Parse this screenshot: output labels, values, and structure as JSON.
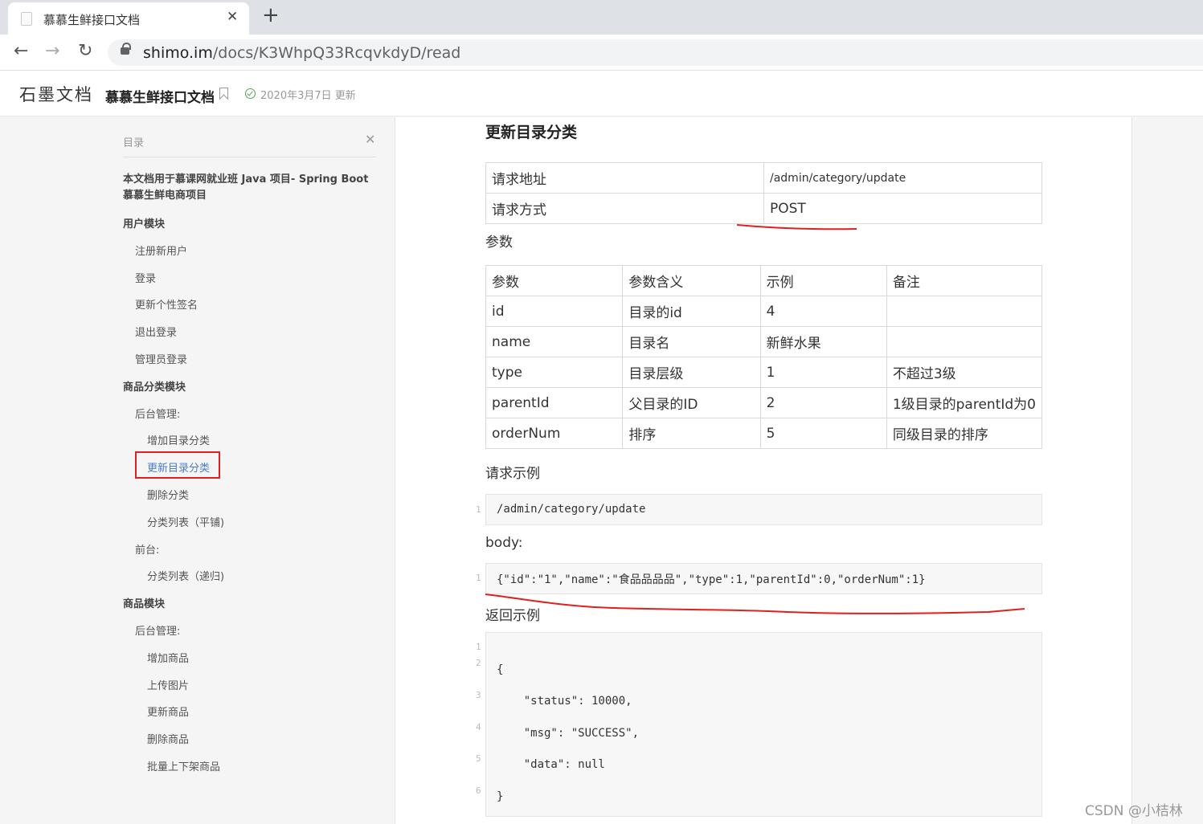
{
  "browser": {
    "tab_title": "慕慕生鲜接口文档",
    "tab_close": "✕",
    "new_tab": "+",
    "back": "←",
    "forward": "→",
    "reload": "↻",
    "url_host": "shimo.im",
    "url_path": "/docs/K3WhpQ33RcqvkdyD/read"
  },
  "header": {
    "logo": "石墨文档",
    "doc_title": "慕慕生鲜接口文档",
    "update": "2020年3月7日 更新"
  },
  "toc": {
    "label": "目录",
    "close": "✕",
    "intro": [
      "本文档用于慕课网就业班 Java 项目- Spring Boot",
      "慕慕生鲜电商项目"
    ],
    "items": [
      {
        "text": "用户模块",
        "level": 1
      },
      {
        "text": "注册新用户",
        "level": 2
      },
      {
        "text": "登录",
        "level": 2
      },
      {
        "text": "更新个性签名",
        "level": 2
      },
      {
        "text": "退出登录",
        "level": 2
      },
      {
        "text": "管理员登录",
        "level": 2
      },
      {
        "text": "商品分类模块",
        "level": 1
      },
      {
        "text": "后台管理:",
        "level": 2
      },
      {
        "text": "增加目录分类",
        "level": 3
      },
      {
        "text": "更新目录分类",
        "level": 3,
        "active": true
      },
      {
        "text": "删除分类",
        "level": 3
      },
      {
        "text": "分类列表（平铺)",
        "level": 3
      },
      {
        "text": "前台:",
        "level": 2
      },
      {
        "text": "分类列表（递归)",
        "level": 3
      },
      {
        "text": "商品模块",
        "level": 1
      },
      {
        "text": "后台管理:",
        "level": 2
      },
      {
        "text": "增加商品",
        "level": 3
      },
      {
        "text": "上传图片",
        "level": 3
      },
      {
        "text": "更新商品",
        "level": 3
      },
      {
        "text": "删除商品",
        "level": 3
      },
      {
        "text": "批量上下架商品",
        "level": 3
      }
    ]
  },
  "content": {
    "heading": "更新目录分类",
    "request_table": [
      [
        "请求地址",
        "/admin/category/update"
      ],
      [
        "请求方式",
        "POST"
      ]
    ],
    "params_label": "参数",
    "params_table": {
      "headers": [
        "参数",
        "参数含义",
        "示例",
        "备注"
      ],
      "rows": [
        [
          "id",
          "目录的id",
          "4",
          ""
        ],
        [
          "name",
          "目录名",
          "新鲜水果",
          ""
        ],
        [
          "type",
          "目录层级",
          "1",
          "不超过3级"
        ],
        [
          "parentId",
          "父目录的ID",
          "2",
          "1级目录的parentId为0"
        ],
        [
          "orderNum",
          "排序",
          "5",
          "同级目录的排序"
        ]
      ]
    },
    "request_example_label": "请求示例",
    "request_example_code": [
      "/admin/category/update"
    ],
    "body_label": "body:",
    "body_code": [
      "{\"id\":\"1\",\"name\":\"食品品品品\",\"type\":1,\"parentId\":0,\"orderNum\":1}"
    ],
    "response_example_label": "返回示例",
    "response_code": [
      "",
      "{",
      "    \"status\": 10000,",
      "    \"msg\": \"SUCCESS\",",
      "    \"data\": null",
      "}"
    ]
  },
  "watermark": "CSDN @小桔林",
  "annotation_color": "#e02020"
}
